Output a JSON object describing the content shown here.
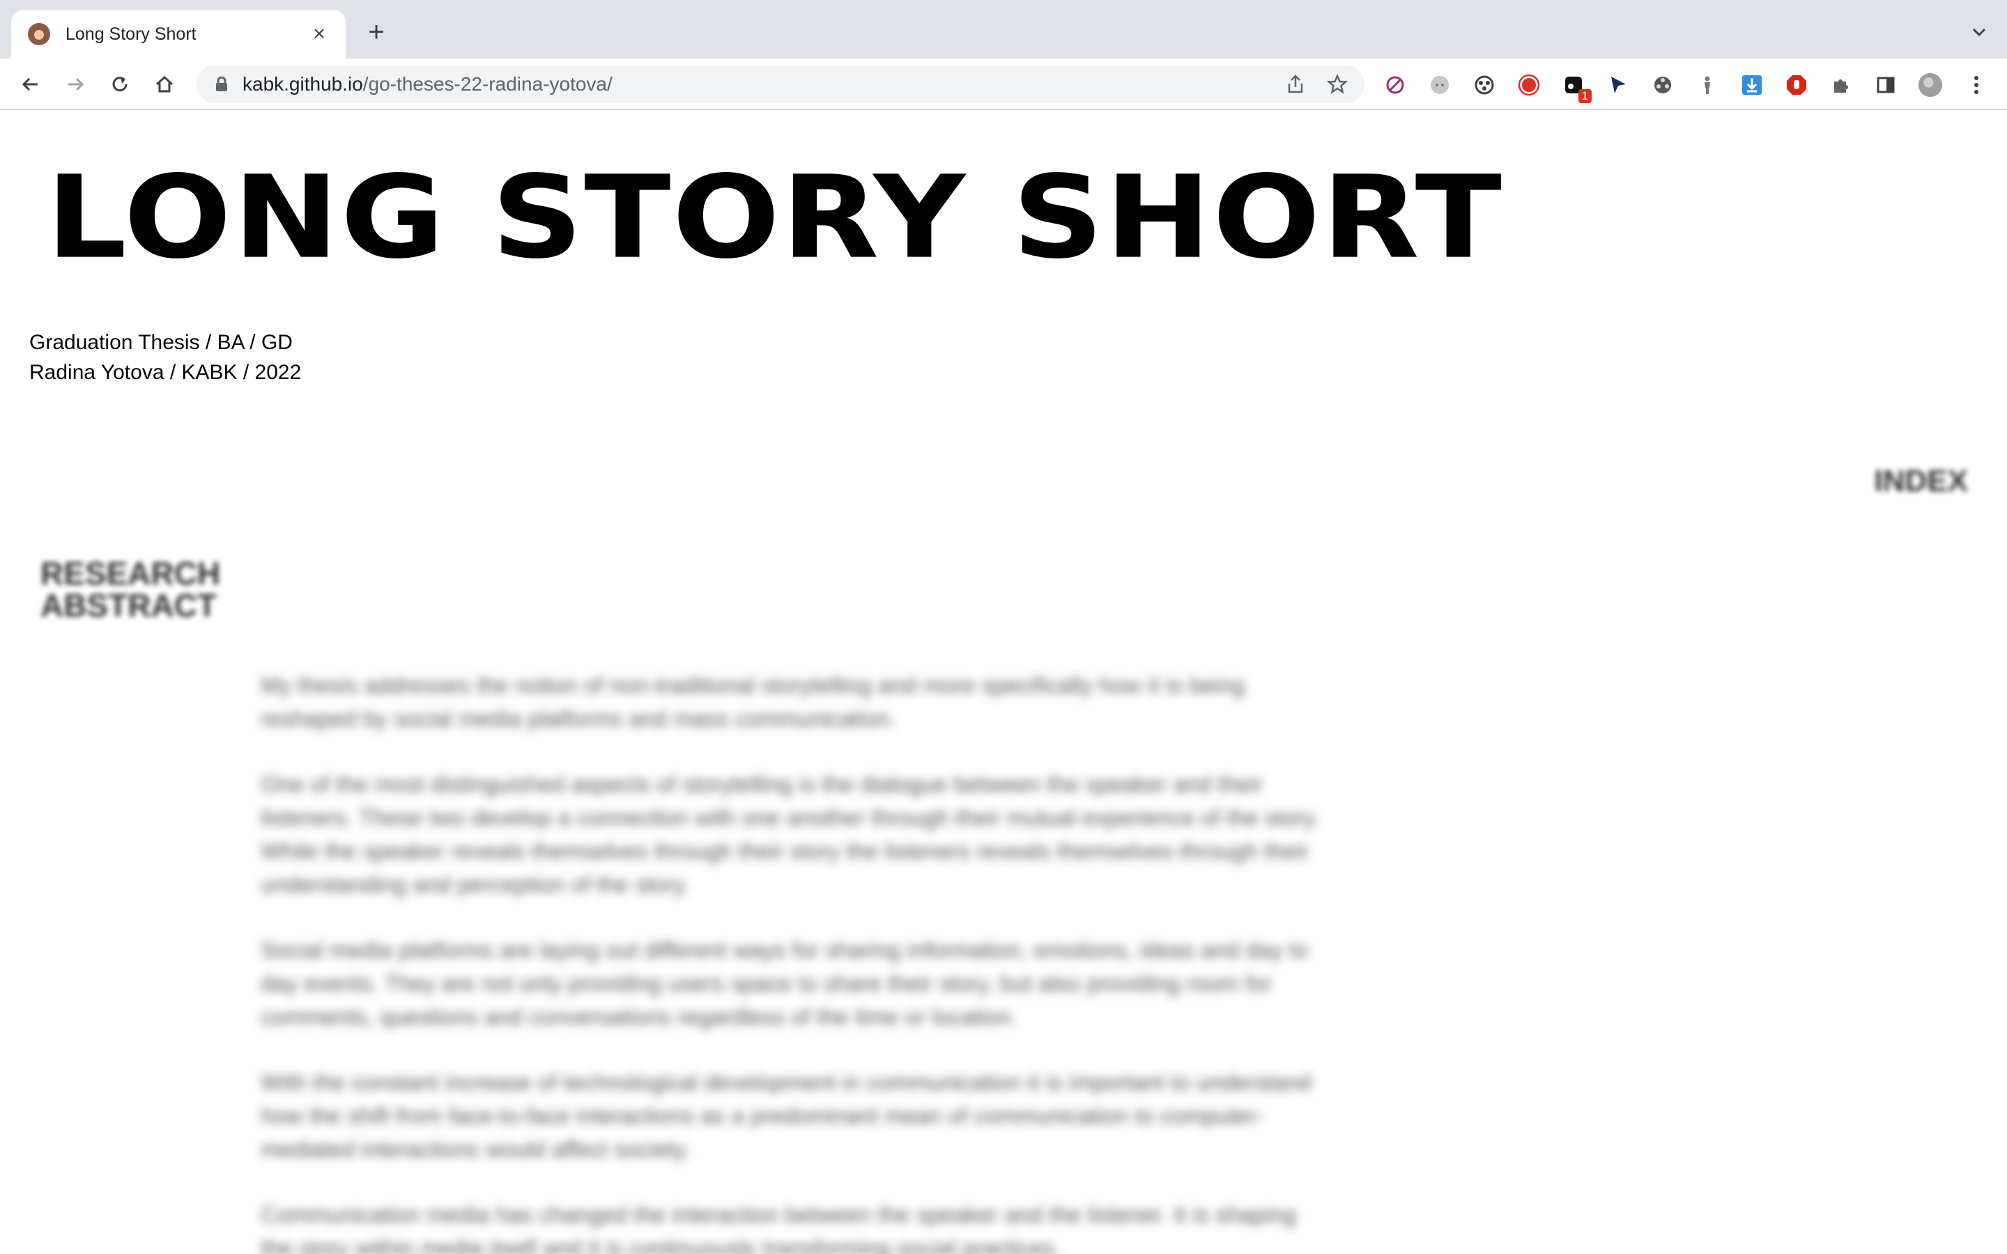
{
  "browser": {
    "tab_title": "Long Story Short",
    "tab_close": "×",
    "new_tab": "+",
    "url_host": "kabk.github.io",
    "url_path": "/go-theses-22-radina-yotova/",
    "extension_badge": "1",
    "extensions": [
      "block-icon",
      "dots-icon",
      "paw-icon",
      "record-icon",
      "notification-icon",
      "cursor-icon",
      "film-icon",
      "person-icon",
      "download-icon",
      "stop-hand-icon",
      "puzzle-icon",
      "side-panel-icon",
      "profile-avatar"
    ]
  },
  "page": {
    "title": "LONG STORY SHORT",
    "meta_line1": "Graduation Thesis / BA / GD",
    "meta_line2": "Radina Yotova / KABK / 2022",
    "index_label": "INDEX",
    "section_line1": "RESEARCH",
    "section_line2": "ABSTRACT",
    "paragraphs": [
      "My thesis addresses the notion of non-traditional storytelling and more specifically how it is being reshaped by social media platforms and mass communication.",
      "One of the most distinguished aspects of storytelling is the dialogue between the speaker and their listeners. These two develop a connection with one another through their mutual experience of the story. While the speaker reveals themselves through their story the listeners reveals themselves through their understanding and perception of the story.",
      "Social media platforms are laying out different ways for sharing information, emotions, ideas and day to day events. They are not only providing users space to share their story, but also providing room for comments, questions and conversations regardless of the time or location.",
      "With the constant increase of technological development in communication it is important to understand how the shift from face-to-face interactions as a predominant mean of communication to computer-mediated interactions would affect society.",
      "Communication media has changed the interaction between the speaker and the listener. It is shaping the story within media itself and it is continuously transforming social practices."
    ]
  }
}
